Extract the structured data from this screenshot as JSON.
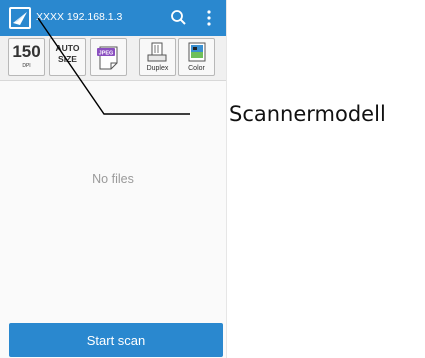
{
  "header": {
    "title": "XXXX  192.168.1.3",
    "icons": [
      "app-logo-icon",
      "search-icon",
      "more-vert-icon"
    ],
    "color": "#2a88cf"
  },
  "toolbar": {
    "dpi_value": "150",
    "dpi_unit": "DPI",
    "size_line1": "AUTO",
    "size_line2": "SIZE",
    "format_label": "JPEG",
    "duplex_label": "Duplex",
    "color_label": "Color"
  },
  "main": {
    "empty_text": "No files"
  },
  "footer": {
    "start_label": "Start scan"
  },
  "annotation": {
    "label": "Scannermodell"
  }
}
